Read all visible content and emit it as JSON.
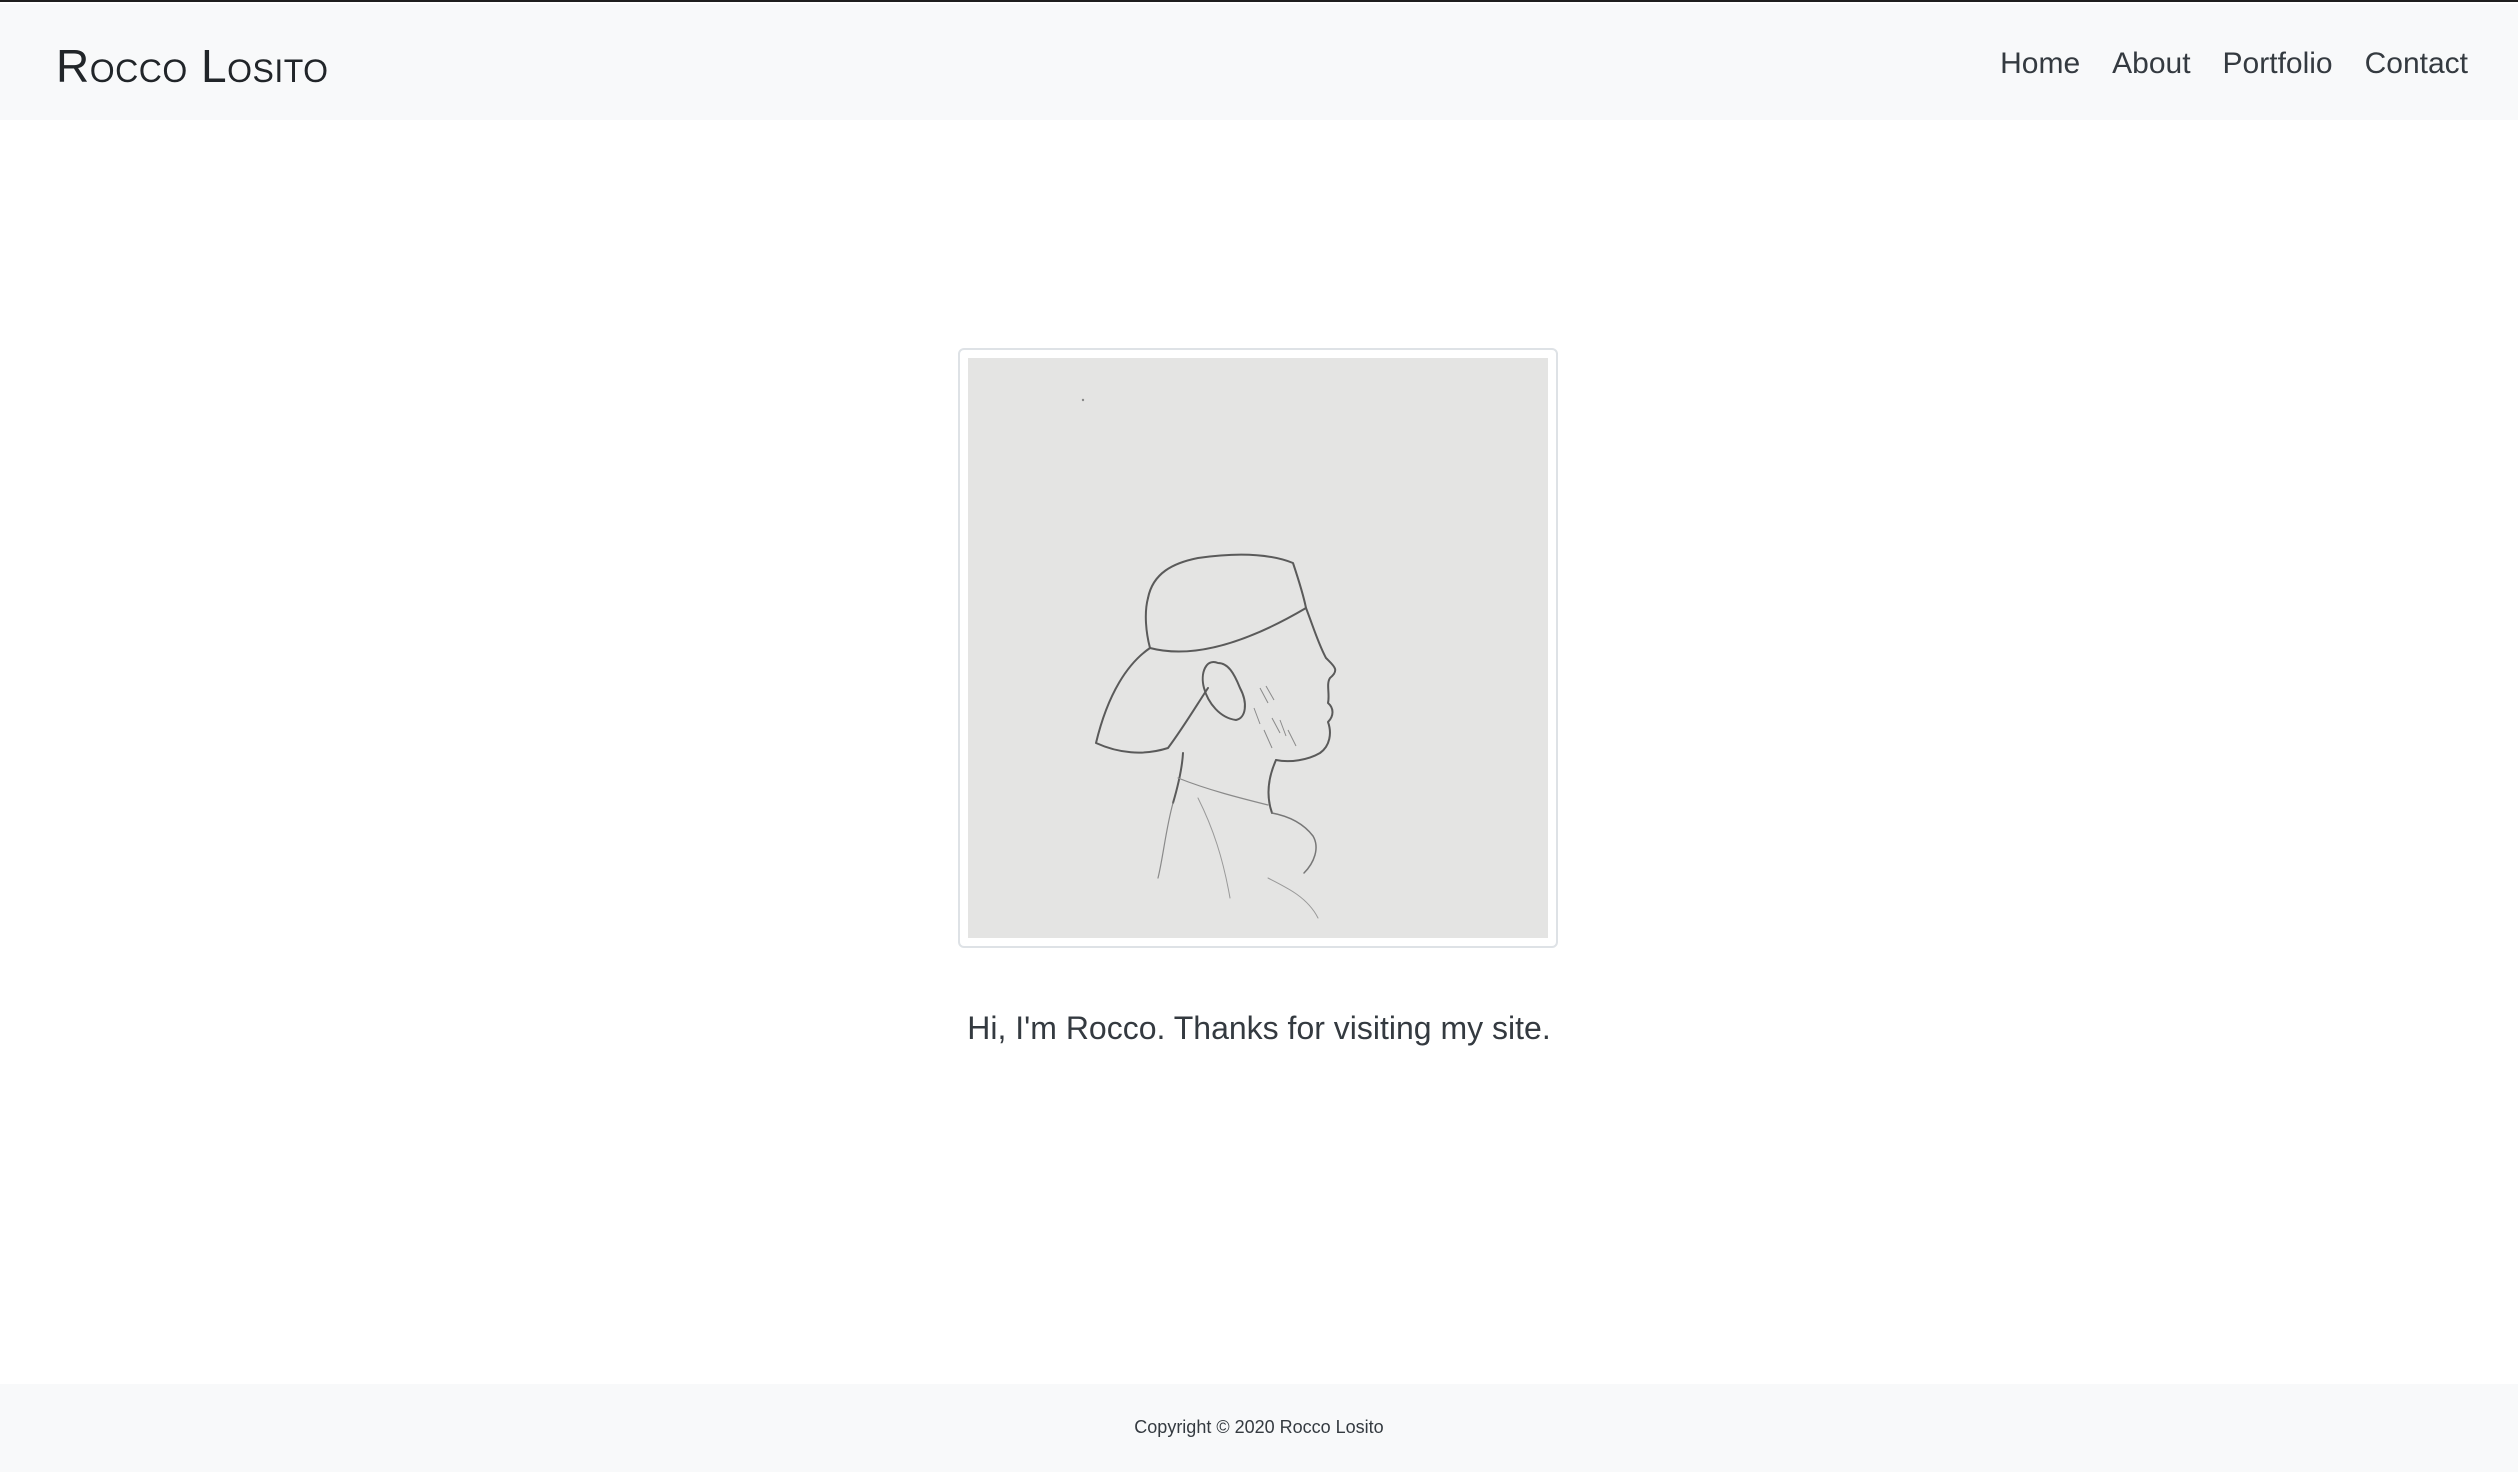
{
  "header": {
    "brand": "Rocco Losito",
    "nav": [
      {
        "label": "Home"
      },
      {
        "label": "About"
      },
      {
        "label": "Portfolio"
      },
      {
        "label": "Contact"
      }
    ]
  },
  "main": {
    "portrait_subject": "pencil-sketch-profile-portrait",
    "greeting": "Hi, I'm Rocco. Thanks for visiting my site."
  },
  "footer": {
    "copyright": "Copyright © 2020 Rocco Losito"
  },
  "colors": {
    "header_background": "#f8f9fa",
    "footer_background": "#f8f9fa",
    "text": "#343a40",
    "portrait_paper": "#e4e4e3",
    "frame_border": "#dee2e6"
  }
}
